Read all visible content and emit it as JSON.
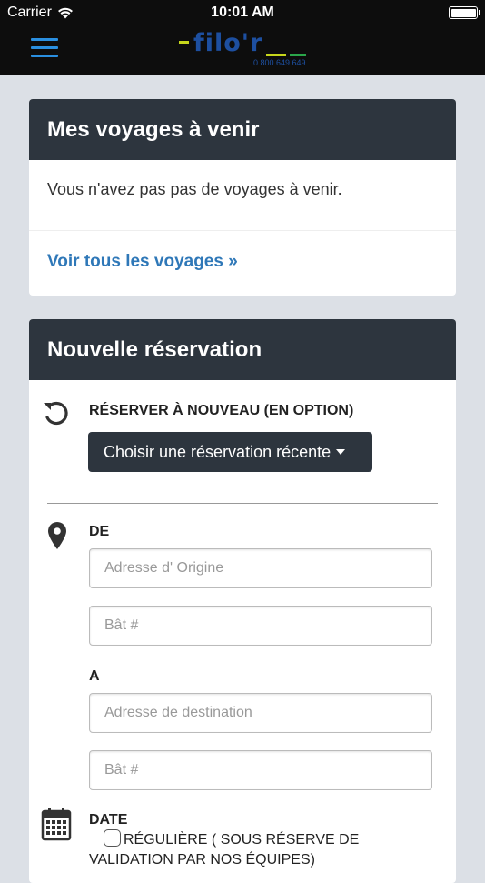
{
  "status_bar": {
    "carrier": "Carrier",
    "time": "10:01 AM"
  },
  "nav": {
    "logo_text": "filo'r",
    "logo_phone": "0 800 649 649"
  },
  "upcoming": {
    "title": "Mes voyages à venir",
    "empty_message": "Vous n'avez pas pas de voyages à venir.",
    "see_all_link": "Voir tous les voyages »"
  },
  "new_booking": {
    "title": "Nouvelle réservation",
    "rebook_label": "RÉSERVER À NOUVEAU (EN OPTION)",
    "recent_dropdown_label": "Choisir une réservation récente",
    "from_label": "DE",
    "origin_placeholder": "Adresse d' Origine",
    "origin_building_placeholder": "Bât #",
    "to_label": "A",
    "destination_placeholder": "Adresse de destination",
    "destination_building_placeholder": "Bât #",
    "date_label": "DATE",
    "recurring_label": "RÉGULIÈRE ( SOUS RÉSERVE DE VALIDATION PAR NOS ÉQUIPES)"
  },
  "icons": [
    "wifi-icon",
    "battery-icon",
    "hamburger-menu-icon",
    "history-icon",
    "location-pin-icon",
    "calendar-icon"
  ],
  "colors": {
    "header_dark": "#2d353e",
    "link_blue": "#2f78b8",
    "menu_blue": "#2a8fe0",
    "background": "#dce0e6"
  }
}
